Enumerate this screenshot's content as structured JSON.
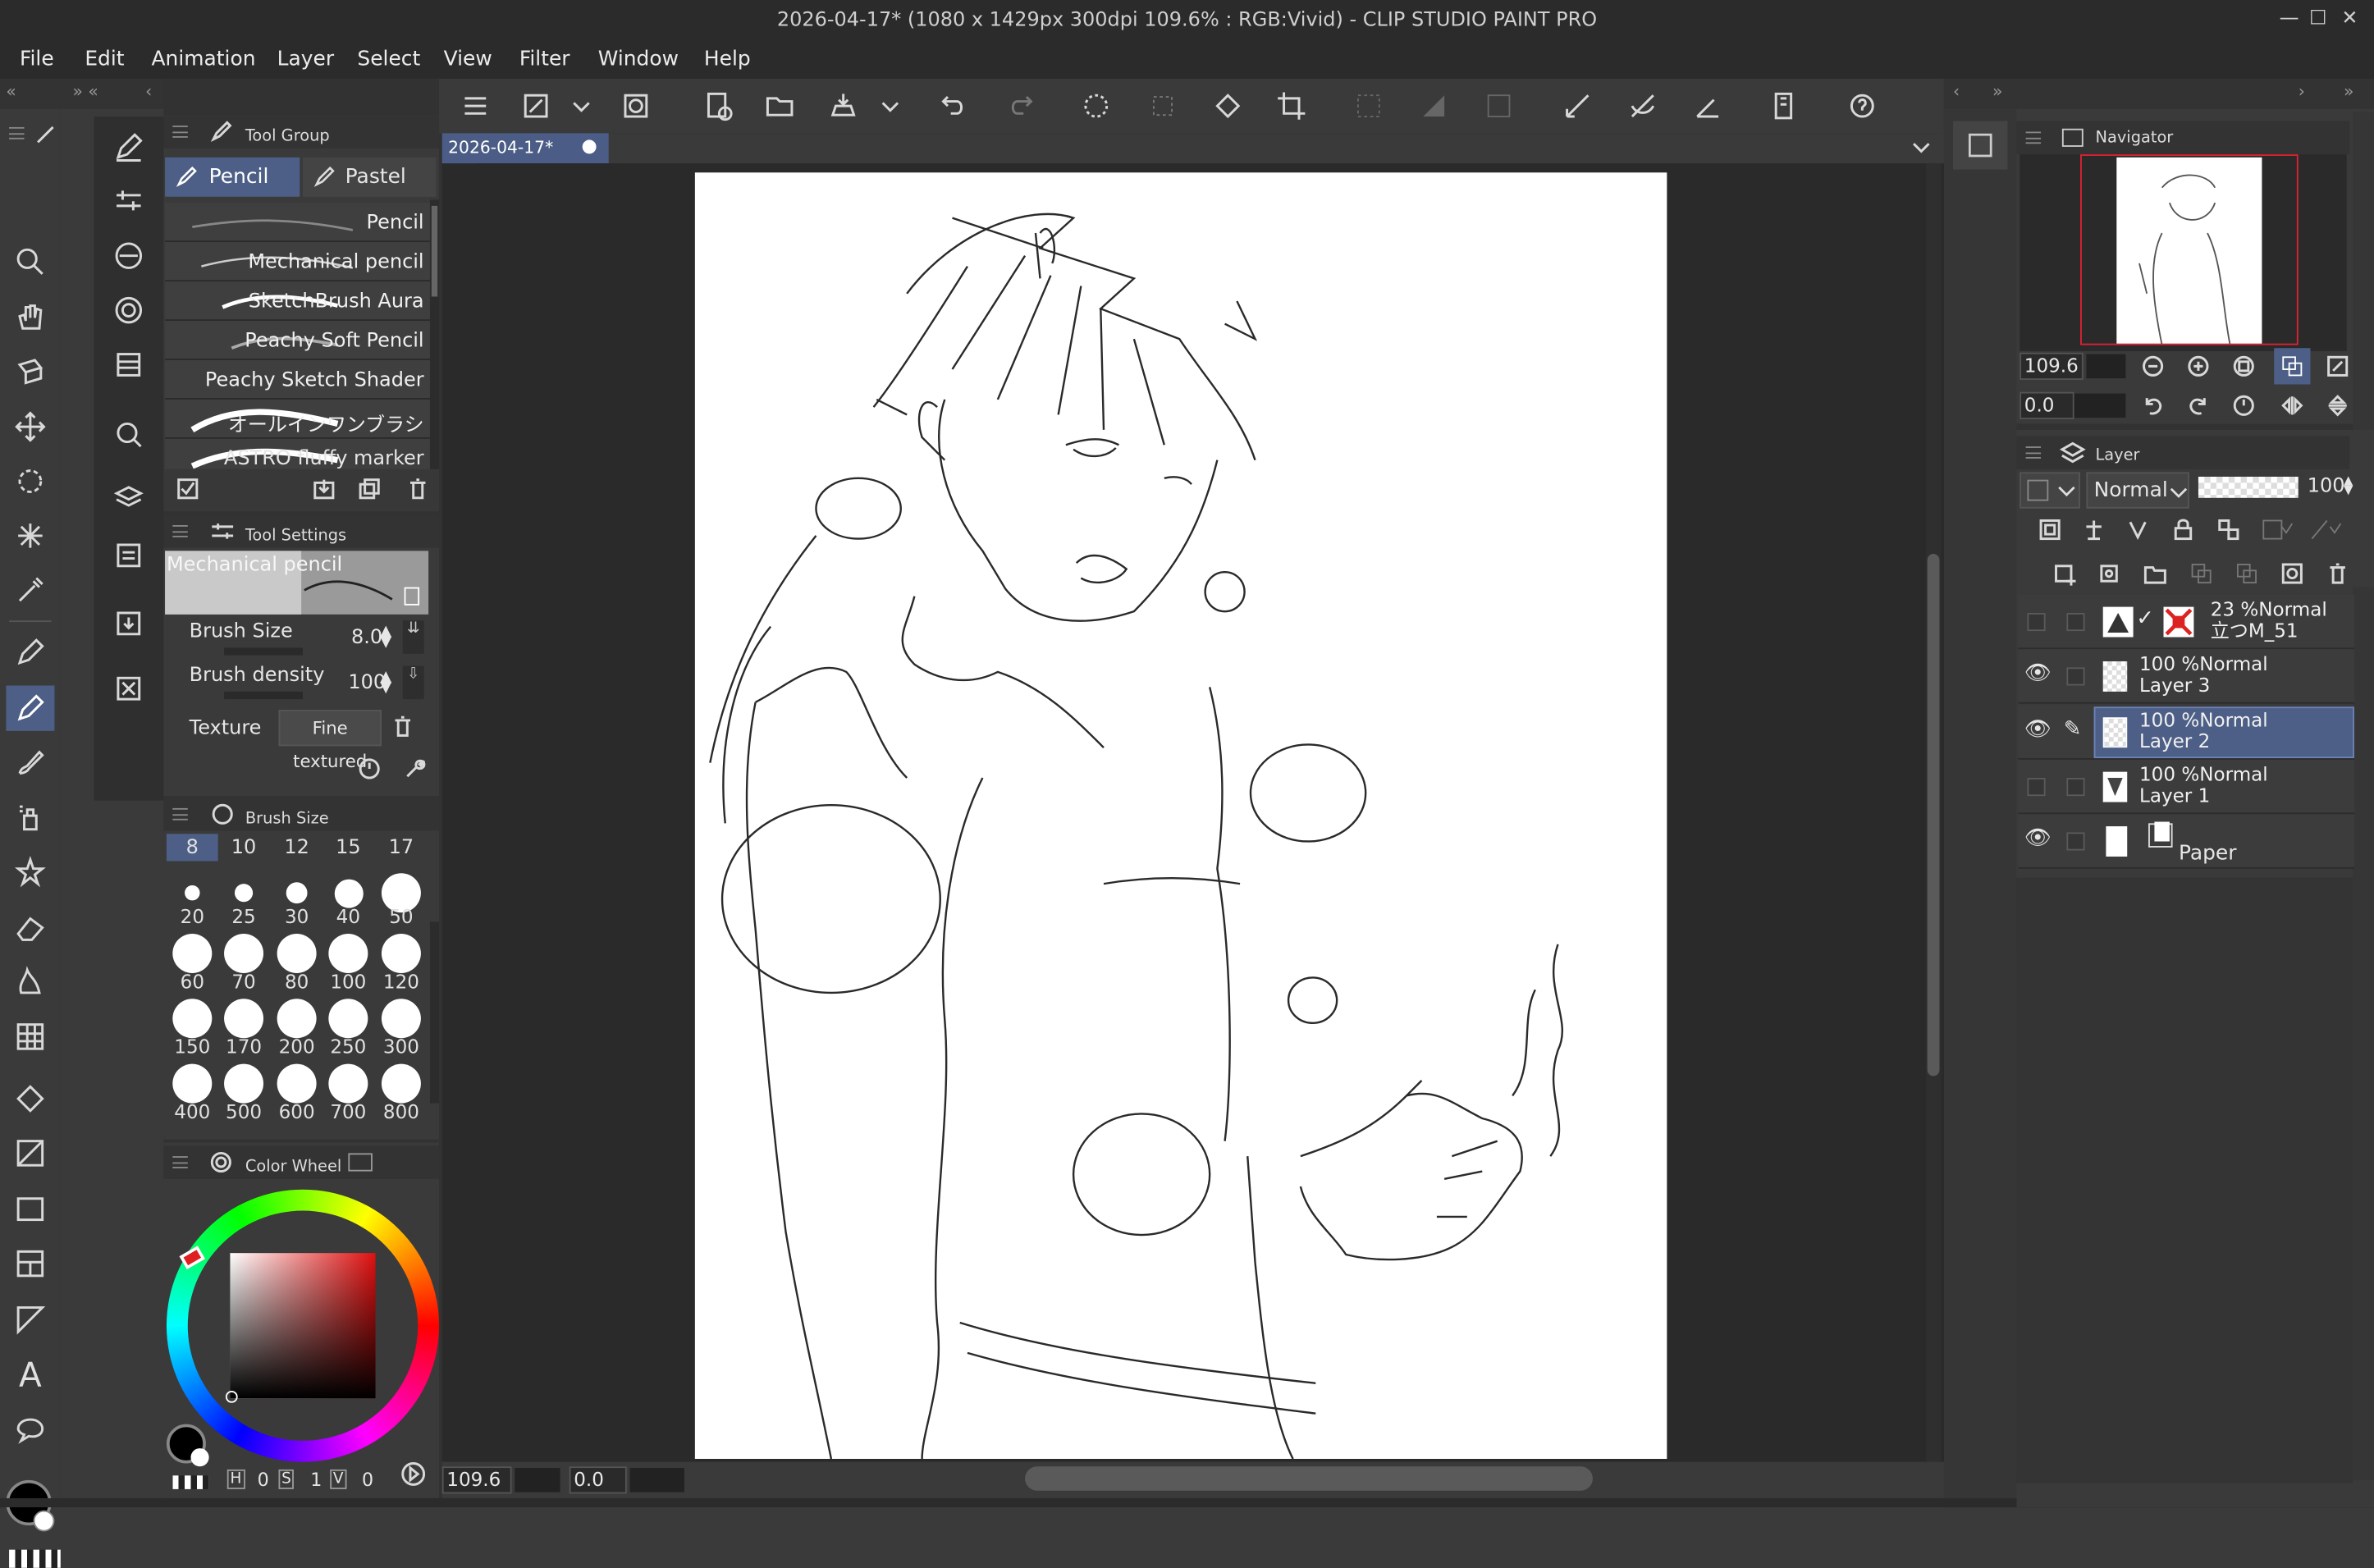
{
  "window": {
    "title": "2026-04-17* (1080 x 1429px 300dpi 109.6% : RGB:Vivid)  - CLIP STUDIO PAINT PRO",
    "min": "—",
    "max": "☐",
    "close": "✕"
  },
  "menu": [
    "File",
    "Edit",
    "Animation",
    "Layer",
    "Select",
    "View",
    "Filter",
    "Window",
    "Help"
  ],
  "canvas": {
    "tab_label": "2026-04-17*",
    "zoom": "109.6",
    "rotation": "0.0"
  },
  "tool_group": {
    "title": "Tool Group",
    "tabs": [
      {
        "label": "Pencil"
      },
      {
        "label": "Pastel"
      }
    ],
    "brushes": [
      {
        "label": "Pencil"
      },
      {
        "label": "Mechanical pencil"
      },
      {
        "label": "SketchBrush Aura"
      },
      {
        "label": "Peachy Soft Pencil"
      },
      {
        "label": "Peachy Sketch Shader"
      },
      {
        "label": "オールインワンブラシ"
      },
      {
        "label": "ASTRO fluffy marker"
      }
    ]
  },
  "tool_settings": {
    "title": "Tool Settings",
    "preset": "Mechanical pencil",
    "brush_size_label": "Brush Size",
    "brush_size_value": "8.0",
    "brush_density_label": "Brush density",
    "brush_density_value": "100",
    "texture_label": "Texture",
    "texture_value": "Fine textured"
  },
  "brush_size_panel": {
    "title": "Brush Size",
    "sizes": [
      "8",
      "10",
      "12",
      "15",
      "17",
      "20",
      "25",
      "30",
      "40",
      "50",
      "60",
      "70",
      "80",
      "100",
      "120",
      "150",
      "170",
      "200",
      "250",
      "300",
      "400",
      "500",
      "600",
      "700",
      "800"
    ]
  },
  "color_panel": {
    "title": "Color Wheel",
    "h_label": "H",
    "h_value": "0",
    "s_label": "S",
    "s_value": "1",
    "v_label": "V",
    "v_value": "0",
    "main_color": "#000000",
    "sub_color": "#ffffff",
    "hue_color": "#e02020"
  },
  "navigator": {
    "title": "Navigator",
    "zoom": "109.6",
    "rotation": "0.0"
  },
  "layer_panel": {
    "title": "Layer",
    "blend_mode": "Normal",
    "opacity": "100",
    "layers": [
      {
        "percent": "23 %",
        "mode": "Normal",
        "name": "立つM_51"
      },
      {
        "percent": "100 %",
        "mode": "Normal",
        "name": "Layer 3"
      },
      {
        "percent": "100 %",
        "mode": "Normal",
        "name": "Layer 2"
      },
      {
        "percent": "100 %",
        "mode": "Normal",
        "name": "Layer 1"
      },
      {
        "percent": "",
        "mode": "",
        "name": "Paper"
      }
    ]
  }
}
